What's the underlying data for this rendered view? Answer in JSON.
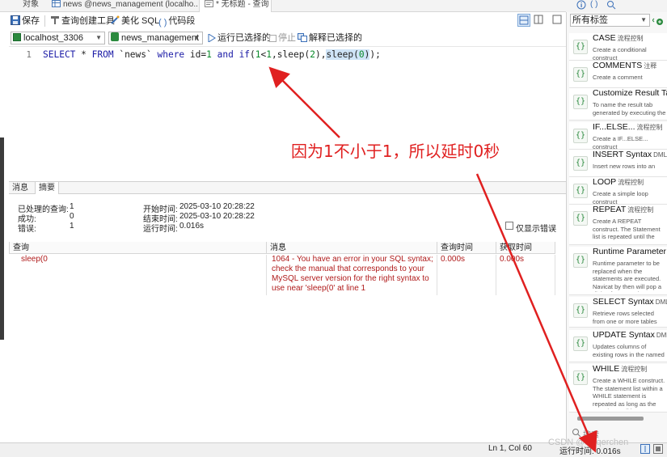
{
  "tabs": [
    {
      "label": "对象"
    },
    {
      "label": "news @news_management (localho..."
    },
    {
      "label": "* 无标题 - 查询"
    }
  ],
  "toolbar": {
    "save": "保存",
    "query_builder": "查询创建工具",
    "beautify": "美化 SQL",
    "snippet": "代码段"
  },
  "connection_bar": {
    "connection": "localhost_3306",
    "database": "news_management",
    "run_selected": "运行已选择的",
    "stop": "停止",
    "explain_selected": "解释已选择的"
  },
  "editor": {
    "line_number": "1",
    "code_parts": {
      "p1": "SELECT",
      "p2": " * ",
      "p3": "FROM",
      "p4": " `news` ",
      "p5": "where",
      "p6": " id=",
      "p7": "1",
      "p8": " and ",
      "p9": "if",
      "p10": "(",
      "p11": "1",
      "p12": "<",
      "p13": "1",
      "p14": ",sleep(",
      "p15": "2",
      "p16": "),",
      "p17": "sleep(",
      "p18": "0",
      "p19": ")",
      "p20": ");"
    }
  },
  "annotation": "因为1不小于1，所以延时0秒",
  "result_tabs": [
    {
      "label": "消息"
    },
    {
      "label": "摘要"
    }
  ],
  "summary": {
    "processed_label": "已处理的查询:",
    "processed_value": "1",
    "success_label": "成功:",
    "success_value": "0",
    "error_label": "错误:",
    "error_value": "1",
    "start_label": "开始时间:",
    "start_value": "2025-03-10 20:28:22",
    "end_label": "结束时间:",
    "end_value": "2025-03-10 20:28:22",
    "runtime_label": "运行时间:",
    "runtime_value": "0.016s",
    "only_errors": "仅显示错误"
  },
  "result_table": {
    "headers": [
      "查询",
      "消息",
      "查询时间",
      "获取时间"
    ],
    "row": {
      "query": "sleep(0",
      "message_lines": [
        "1064 - You have an error in your SQL syntax;",
        "check the manual that corresponds to your",
        "MySQL server version for the right syntax to",
        "use near 'sleep(0' at line 1"
      ],
      "query_time": "0.000s",
      "fetch_time": "0.000s"
    }
  },
  "status_bar": {
    "position": "Ln 1, Col 60",
    "runtime": "运行时间: 0.016s",
    "watermark": "CSDN @Jiuqerchen"
  },
  "right_panel": {
    "filter": "所有标签",
    "search": "搜索",
    "snippets": [
      {
        "title": "CASE",
        "tag": "流程控制",
        "desc": "Create a conditional construct"
      },
      {
        "title": "COMMENTS",
        "tag": "注释",
        "desc": "Create a comment"
      },
      {
        "title": "Customize Result Tab",
        "tag": "",
        "desc": "To name the result tab generated by executing the statement."
      },
      {
        "title": "IF...ELSE...",
        "tag": "流程控制",
        "desc": "Create a IF...ELSE... construct"
      },
      {
        "title": "INSERT Syntax",
        "tag": "DML",
        "desc": "Insert new rows into an existing table"
      },
      {
        "title": "LOOP",
        "tag": "流程控制",
        "desc": "Create a simple loop construct"
      },
      {
        "title": "REPEAT",
        "tag": "流程控制",
        "desc": "Create A REPEAT construct. The Statement list is repeated until the search_condition expression is true."
      },
      {
        "title": "Runtime Parameter",
        "tag": "",
        "desc": "Runtime parameter to be replaced when the statements are executed. Navicat by then will pop a dialog for you to input value."
      },
      {
        "title": "SELECT Syntax",
        "tag": "DML",
        "desc": "Retrieve rows selected from one or more tables"
      },
      {
        "title": "UPDATE Syntax",
        "tag": "DML",
        "desc": "Updates columns of existing rows in the named table with new values"
      },
      {
        "title": "WHILE",
        "tag": "流程控制",
        "desc": "Create a WHILE construct. The statement list within a WHILE statement is repeated as long as the search_condition expression is true."
      }
    ]
  },
  "colors": {
    "annotation_red": "#e02020",
    "keyword_blue": "#1a1aa6",
    "number_green": "#0a8a2a",
    "error_red": "#b01b1b",
    "highlight": "#cfe4f7"
  }
}
